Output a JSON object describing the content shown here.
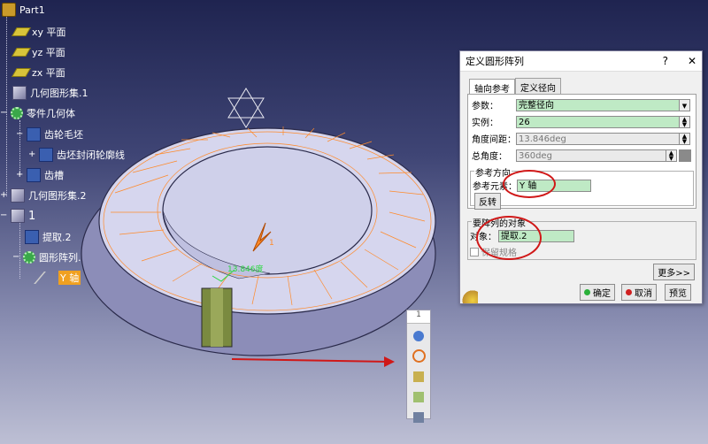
{
  "tree": {
    "root": "Part1",
    "items": [
      {
        "label": "xy 平面"
      },
      {
        "label": "yz 平面"
      },
      {
        "label": "zx 平面"
      },
      {
        "label": "几何图形集.1"
      },
      {
        "label": "零件几何体"
      },
      {
        "label": "齿轮毛坯"
      },
      {
        "label": "齿坯封闭轮廓线"
      },
      {
        "label": "齿槽"
      },
      {
        "label": "几何图形集.2"
      },
      {
        "label": "1"
      },
      {
        "label": "提取.2"
      },
      {
        "label": "圆形阵列.2"
      },
      {
        "label": "Y 轴"
      }
    ]
  },
  "viewport": {
    "angle_label": "13.846度",
    "small_label": "1"
  },
  "dialog": {
    "title": "定义圆形阵列",
    "help": "?",
    "close": "✕",
    "tabs": [
      "轴向参考",
      "定义径向"
    ],
    "params_label": "参数：",
    "params_value": "完整径向",
    "instances_label": "实例：",
    "instances_value": "26",
    "angle_spacing_label": "角度间距：",
    "angle_spacing_value": "13.846deg",
    "total_angle_label": "总角度：",
    "total_angle_value": "360deg",
    "ref_dir_title": "参考方向",
    "ref_element_label": "参考元素：",
    "ref_element_value": "Y 轴",
    "reverse_label": "反转",
    "object_group_title": "要阵列的对象",
    "object_label": "对象：",
    "object_value": "提取.2",
    "keep_spec_label": "保留规格",
    "more_label": "更多>>",
    "ok_label": "确定",
    "cancel_label": "取消",
    "preview_label": "预览"
  },
  "toolbar": {
    "header": "1"
  },
  "colors": {
    "accent_red": "#d01818",
    "field_green": "#bfeac5",
    "wireframe_orange": "#ff8a2a"
  }
}
